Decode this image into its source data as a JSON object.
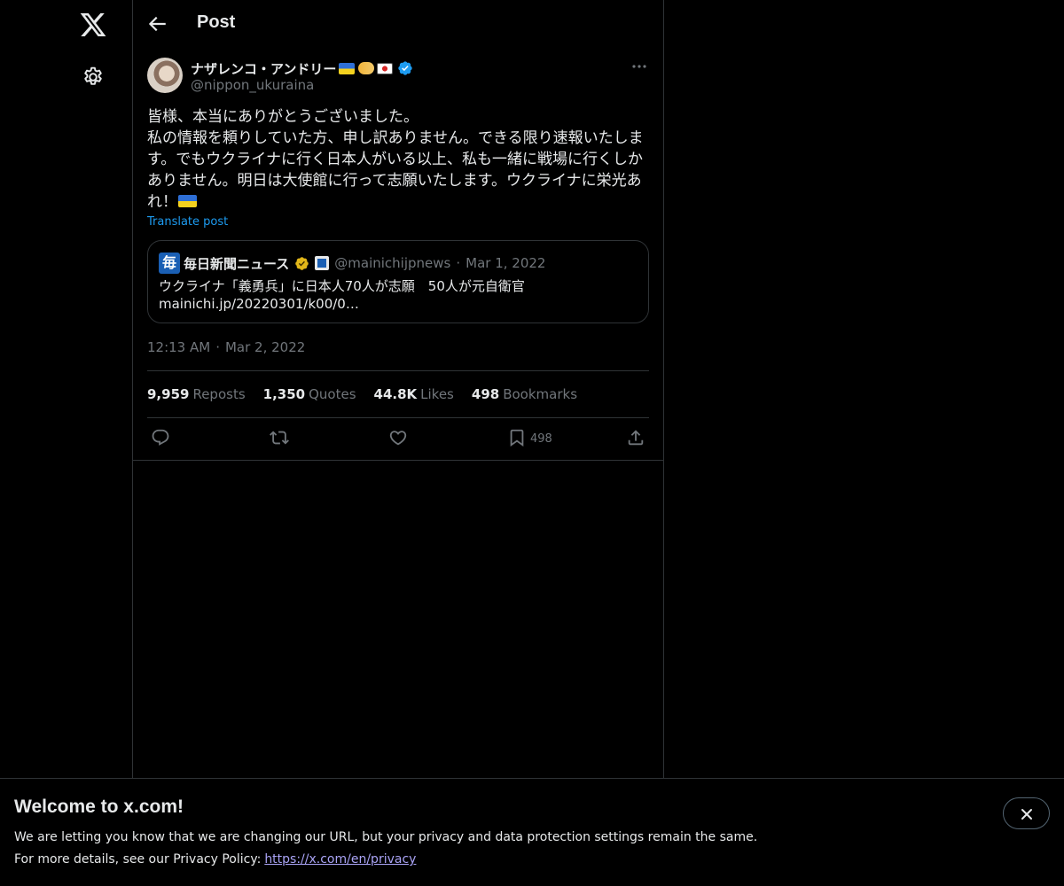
{
  "header": {
    "title": "Post"
  },
  "tweet": {
    "display_name": "ナザレンコ・アンドリー",
    "handle": "@nippon_ukuraina",
    "body": "皆様、本当にありがとうございました。\n私の情報を頼りしていた方、申し訳ありません。できる限り速報いたします。でもウクライナに行く日本人がいる以上、私も一緒に戦場に行くしかありません。明日は大使館に行って志願いたします。ウクライナに栄光あれ！",
    "translate_label": "Translate post",
    "time": "12:13 AM",
    "date": "Mar 2, 2022",
    "separator": "·",
    "stats": {
      "reposts_num": "9,959",
      "reposts_label": "Reposts",
      "quotes_num": "1,350",
      "quotes_label": "Quotes",
      "likes_num": "44.8K",
      "likes_label": "Likes",
      "bookmarks_num": "498",
      "bookmarks_label": "Bookmarks"
    },
    "bookmark_count": "498"
  },
  "quote": {
    "logo_char": "毎",
    "name": "毎日新聞ニュース",
    "handle": "@mainichijpnews",
    "separator": "·",
    "date": "Mar 1, 2022",
    "line1": "ウクライナ「義勇兵」に日本人70人が志願　50人が元自衛官",
    "line2": "mainichi.jp/20220301/k00/0…"
  },
  "banner": {
    "title": "Welcome to x.com!",
    "line1": "We are letting you know that we are changing our URL, but your privacy and data protection settings remain the same.",
    "line2_prefix": "For more details, see our Privacy Policy:",
    "link": "https://x.com/en/privacy"
  },
  "colors": {
    "background": "#000000",
    "text": "#e7e9ea",
    "muted": "#71767b",
    "accent": "#1d9bf0",
    "border": "#2f3336",
    "link_visited": "#a9a3f5"
  },
  "icons": [
    "x-logo-icon",
    "gear-icon",
    "back-arrow-icon",
    "verified-badge-icon",
    "more-icon",
    "reply-icon",
    "repost-icon",
    "like-icon",
    "bookmark-icon",
    "share-icon",
    "close-icon"
  ]
}
